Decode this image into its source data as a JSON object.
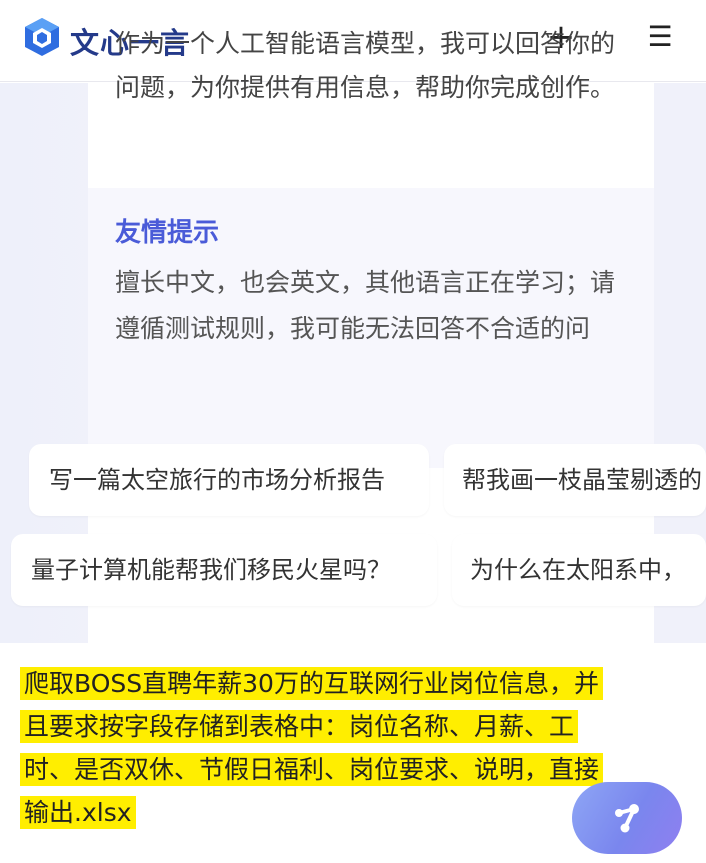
{
  "header": {
    "logo_text": "文心一言",
    "plus_label": "+",
    "menu_label": "☰"
  },
  "welcome": {
    "intro": "作为一个人工智能语言模型，我可以回答你的问题，为你提供有用信息，帮助你完成创作。",
    "tips_title": "友情提示",
    "tips_body": "擅长中文，也会英文，其他语言正在学习；请遵循测试规则，我可能无法回答不合适的问题。"
  },
  "suggestions": [
    "写一篇太空旅行的市场分析报告",
    "帮我画一枝晶莹剔透的",
    "量子计算机能帮我们移民火星吗？",
    "为什么在太阳系中，"
  ],
  "input": {
    "prompt": "爬取BOSS直聘年薪30万的互联网行业岗位信息，并且要求按字段存储到表格中：岗位名称、月薪、工时、是否双休、节假日福利、岗位要求、说明，直接输出.xlsx"
  },
  "colors": {
    "brand": "#243a8a",
    "accent": "#4a5bd8",
    "highlight": "#ffee00"
  },
  "icons": {
    "logo": "wenxin-logo-icon",
    "send": "send-icon"
  }
}
